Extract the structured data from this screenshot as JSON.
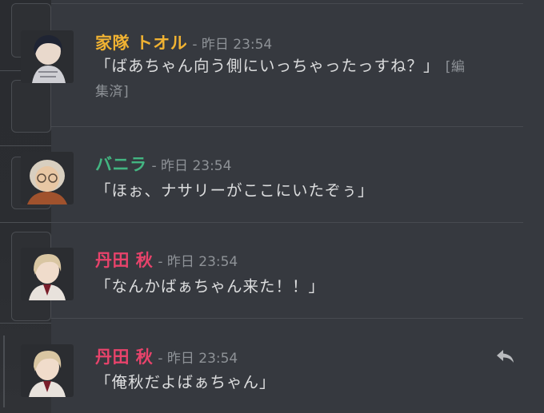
{
  "messages": [
    {
      "author": "家隊 トオル",
      "author_color": "#f0b232",
      "timestamp": "- 昨日 23:54",
      "text_line1": "「ばあちゃん向う側にいっちゃったっすね？」",
      "edited_part1": "[編",
      "text_line2_edited": "集済]"
    },
    {
      "author": "バニラ",
      "author_color": "#43b581",
      "timestamp": "- 昨日 23:54",
      "text": "「ほぉ、ナサリーがここにいたぞぅ」"
    },
    {
      "author": "丹田 秋",
      "author_color": "#e8436b",
      "timestamp": "- 昨日 23:54",
      "text": "「なんかばぁちゃん来た！！」"
    },
    {
      "author": "丹田 秋",
      "author_color": "#e8436b",
      "timestamp": "- 昨日 23:54",
      "text": "「俺秋だよばぁちゃん」"
    }
  ],
  "icons": {
    "reply": "reply-arrow-icon"
  }
}
